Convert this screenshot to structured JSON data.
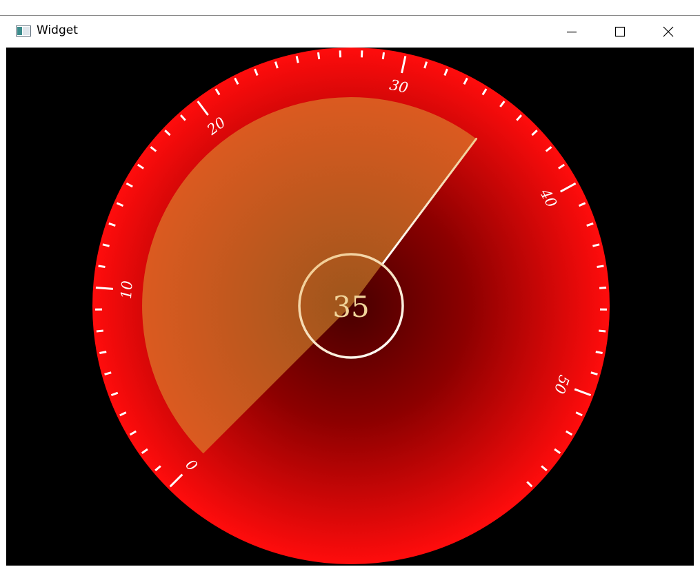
{
  "window": {
    "title": "Widget",
    "app_icon": "window-app-icon",
    "controls": {
      "minimize_icon": "minimize-icon",
      "maximize_icon": "maximize-icon",
      "close_icon": "close-icon"
    }
  },
  "gauge": {
    "value": 35,
    "value_text": "35",
    "min": 0,
    "max": 55,
    "major_step": 10,
    "minor_step": 1,
    "start_angle_deg": 225,
    "end_angle_deg": -45,
    "tick_labels": [
      "0",
      "10",
      "20",
      "30",
      "40",
      "50"
    ],
    "colors": {
      "background": "#000000",
      "outer_ring_edge": "#ff0c0c",
      "outer_ring_center": "#480000",
      "progress_edge": "#db5a20",
      "progress_center": "#9e561c",
      "ticks": "#ffffff",
      "value_text": "#f0d49a",
      "center_ring": "#f0c88a"
    }
  }
}
